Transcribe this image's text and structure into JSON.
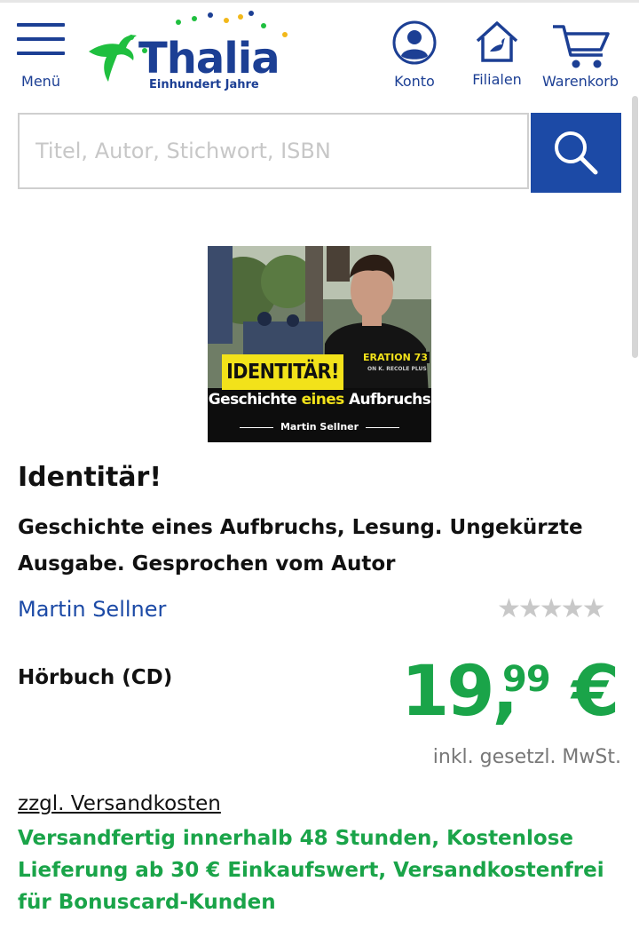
{
  "header": {
    "menu_label": "Menü",
    "logo_text": "Thalia",
    "logo_subtitle": "Einhundert Jahre",
    "account_label": "Konto",
    "stores_label": "Filialen",
    "cart_label": "Warenkorb",
    "brand_color": "#1c3f94"
  },
  "search": {
    "placeholder": "Titel, Autor, Stichwort, ISBN",
    "value": "",
    "button_color": "#1c4aa6"
  },
  "cover": {
    "title": "IDENTITÄR!",
    "subtitle_before": "Geschichte ",
    "subtitle_highlight": "eines",
    "subtitle_after": " Aufbruchs",
    "author": "Martin Sellner",
    "shirt_text": "ERATION 73",
    "shirt_subtext": "ON K. RECOLE PLUS"
  },
  "product": {
    "title": "Identitär!",
    "subtitle": "Geschichte eines Aufbruchs, Lesung. Ungekürzte Ausgabe. Gesprochen vom Autor",
    "author": "Martin Sellner",
    "rating_stars": "★★★★★",
    "rating": 0,
    "format": "Hörbuch (CD)",
    "price_main": "19,",
    "price_cents": "99",
    "currency": "€",
    "price_color": "#1aa449",
    "tax_note": "inkl. gesetzl. MwSt.",
    "shipping_link": "zzgl. Versandkosten",
    "delivery_info": "Versandfertig innerhalb 48 Stunden, Kostenlose Lieferung ab 30 € Einkaufswert, Versandkostenfrei für Bonuscard-Kunden"
  }
}
